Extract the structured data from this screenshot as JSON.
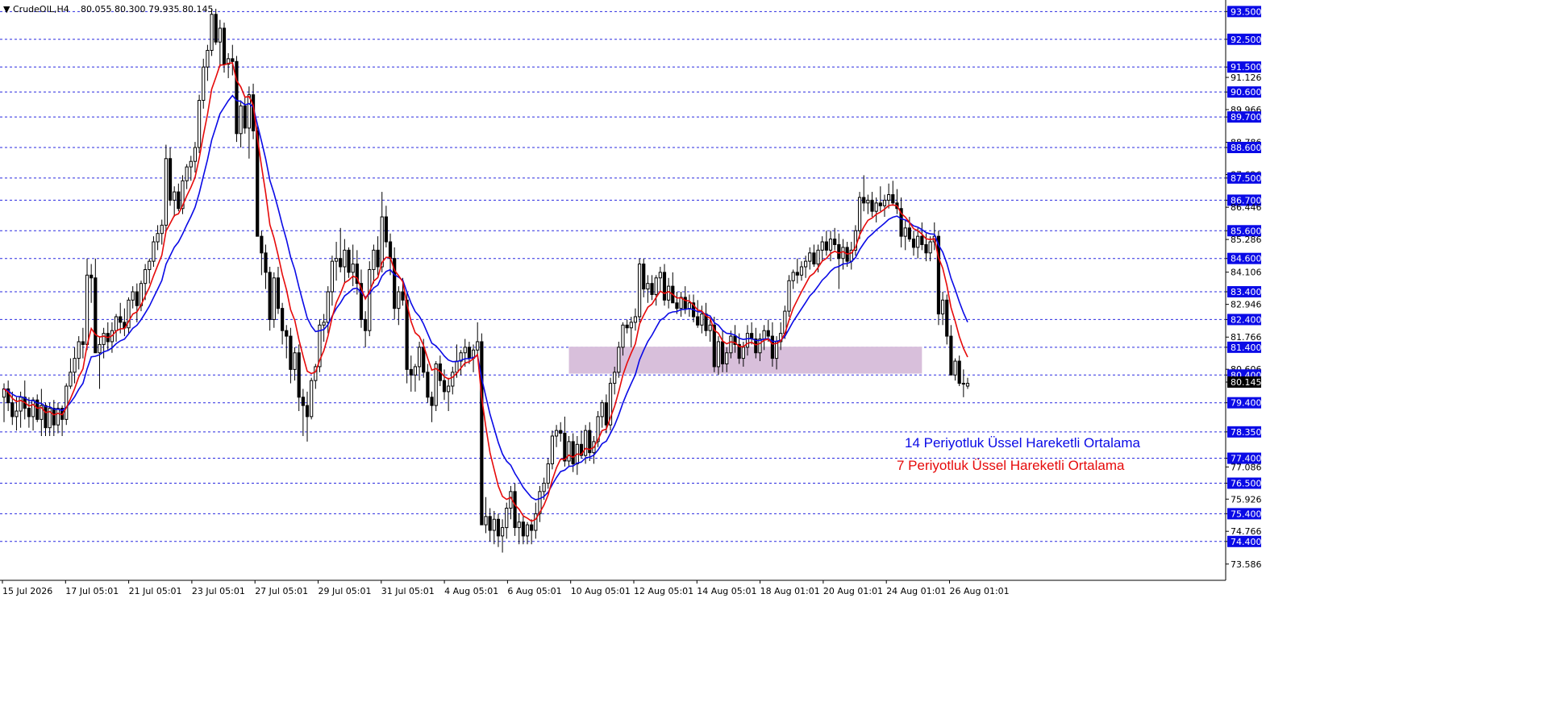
{
  "header": {
    "symbol_tf": "CrudeOIL,H4",
    "ohlc": "80.055 80.300 79.935 80.145"
  },
  "annotations": {
    "ema14_label": "14 Periyotluk Üssel Hareketli Ortalama",
    "ema7_label": "7  Periyotluk Üssel Hareketli Ortalama"
  },
  "colors": {
    "bull": "#ffffff",
    "bear": "#000000",
    "ema14": "#0a0ae6",
    "ema7": "#e60a0a",
    "level_line": "#2a2ae0",
    "level_label_bg": "#0a0ae6",
    "current_price_bg": "#000000",
    "zone_fill": "#d8bfdb"
  },
  "chart_data": {
    "type": "candlestick",
    "ylim": [
      73.0,
      93.8
    ],
    "y_ticks": [
      "93.500",
      "92.500",
      "91.500",
      "91.126",
      "90.600",
      "89.966",
      "89.700",
      "88.786",
      "88.600",
      "87.626",
      "87.500",
      "86.700",
      "86.446",
      "85.600",
      "85.286",
      "84.600",
      "84.106",
      "83.400",
      "82.946",
      "82.400",
      "81.766",
      "81.400",
      "80.606",
      "80.400",
      "80.145",
      "79.400",
      "78.350",
      "77.400",
      "77.086",
      "76.500",
      "75.926",
      "75.400",
      "74.766",
      "74.400",
      "73.586"
    ],
    "levels": [
      93.5,
      92.5,
      91.5,
      90.6,
      89.7,
      88.6,
      87.5,
      86.7,
      85.6,
      84.6,
      83.4,
      82.4,
      81.4,
      80.4,
      79.4,
      78.35,
      77.4,
      76.5,
      75.4,
      74.4
    ],
    "current_price": "80.145",
    "x_labels": [
      "15 Jul 2026",
      "17 Jul 05:01",
      "21 Jul 05:01",
      "23 Jul 05:01",
      "27 Jul 05:01",
      "29 Jul 05:01",
      "31 Jul 05:01",
      "4 Aug 05:01",
      "6 Aug 05:01",
      "10 Aug 05:01",
      "12 Aug 05:01",
      "14 Aug 05:01",
      "18 Aug 01:01",
      "20 Aug 01:01",
      "24 Aug 01:01",
      "26 Aug 01:01"
    ],
    "zone": {
      "from_bar": 136,
      "to_bar": 221,
      "low": 80.45,
      "high": 81.42
    },
    "ohlc": [
      [
        79.6,
        80.1,
        78.7,
        79.9
      ],
      [
        79.9,
        80.2,
        79.1,
        79.4
      ],
      [
        79.4,
        79.8,
        78.6,
        78.9
      ],
      [
        78.9,
        79.6,
        78.4,
        79.1
      ],
      [
        79.1,
        79.8,
        78.5,
        79.6
      ],
      [
        79.6,
        80.2,
        78.8,
        79.2
      ],
      [
        79.2,
        79.6,
        78.5,
        78.9
      ],
      [
        78.9,
        79.6,
        78.4,
        79.5
      ],
      [
        79.5,
        79.7,
        78.7,
        78.8
      ],
      [
        78.8,
        79.9,
        78.2,
        79.3
      ],
      [
        79.3,
        79.4,
        78.2,
        78.5
      ],
      [
        78.5,
        79.4,
        78.2,
        79.2
      ],
      [
        79.2,
        79.5,
        78.2,
        78.6
      ],
      [
        78.6,
        79.4,
        78.3,
        79.2
      ],
      [
        79.2,
        79.3,
        78.2,
        78.8
      ],
      [
        78.8,
        80.1,
        78.6,
        80.0
      ],
      [
        80.0,
        81.0,
        79.9,
        80.5
      ],
      [
        80.5,
        81.4,
        80.1,
        81.0
      ],
      [
        81.0,
        81.8,
        80.6,
        81.6
      ],
      [
        81.6,
        82.1,
        81.0,
        81.5
      ],
      [
        81.5,
        84.6,
        81.3,
        84.0
      ],
      [
        84.0,
        84.4,
        83.0,
        83.9
      ],
      [
        83.9,
        84.6,
        83.0,
        81.2
      ],
      [
        81.2,
        81.8,
        79.9,
        81.5
      ],
      [
        81.5,
        82.1,
        81.0,
        81.9
      ],
      [
        81.9,
        82.3,
        81.3,
        81.6
      ],
      [
        81.6,
        82.3,
        81.2,
        82.0
      ],
      [
        82.0,
        82.6,
        81.6,
        82.5
      ],
      [
        82.5,
        83.0,
        81.9,
        82.3
      ],
      [
        82.3,
        82.8,
        81.8,
        82.1
      ],
      [
        82.1,
        83.2,
        81.9,
        83.1
      ],
      [
        83.1,
        83.6,
        82.8,
        83.4
      ],
      [
        83.4,
        83.7,
        82.3,
        82.9
      ],
      [
        82.9,
        83.8,
        82.7,
        83.7
      ],
      [
        83.7,
        84.4,
        83.1,
        84.2
      ],
      [
        84.2,
        84.6,
        83.7,
        84.5
      ],
      [
        84.5,
        85.4,
        84.3,
        85.2
      ],
      [
        85.2,
        85.8,
        84.9,
        85.5
      ],
      [
        85.5,
        86.0,
        85.1,
        85.8
      ],
      [
        85.8,
        88.7,
        85.6,
        88.2
      ],
      [
        88.2,
        88.6,
        86.5,
        86.7
      ],
      [
        86.7,
        87.2,
        86.1,
        87.0
      ],
      [
        87.0,
        87.3,
        86.3,
        86.4
      ],
      [
        86.4,
        87.6,
        86.2,
        87.4
      ],
      [
        87.4,
        88.0,
        87.1,
        87.9
      ],
      [
        87.9,
        88.3,
        87.4,
        88.1
      ],
      [
        88.1,
        88.8,
        87.7,
        88.6
      ],
      [
        88.6,
        90.5,
        88.4,
        90.3
      ],
      [
        90.3,
        91.8,
        90.0,
        91.5
      ],
      [
        91.5,
        92.3,
        91.0,
        92.1
      ],
      [
        92.1,
        93.6,
        91.9,
        93.4
      ],
      [
        93.4,
        93.6,
        92.3,
        92.4
      ],
      [
        92.4,
        93.2,
        91.5,
        92.9
      ],
      [
        92.9,
        93.1,
        91.3,
        91.6
      ],
      [
        91.6,
        92.0,
        91.1,
        91.8
      ],
      [
        91.8,
        92.3,
        91.2,
        91.7
      ],
      [
        91.7,
        91.9,
        88.8,
        89.1
      ],
      [
        89.1,
        90.3,
        88.6,
        90.1
      ],
      [
        90.1,
        90.4,
        89.1,
        89.3
      ],
      [
        89.3,
        90.8,
        88.2,
        90.5
      ],
      [
        90.5,
        90.9,
        88.9,
        89.2
      ],
      [
        89.2,
        89.4,
        86.2,
        85.4
      ],
      [
        85.4,
        85.6,
        84.0,
        84.8
      ],
      [
        84.8,
        85.1,
        83.5,
        84.1
      ],
      [
        84.1,
        84.3,
        82.0,
        82.4
      ],
      [
        82.4,
        84.1,
        82.1,
        83.9
      ],
      [
        83.9,
        84.3,
        82.6,
        82.8
      ],
      [
        82.8,
        83.0,
        81.5,
        82.0
      ],
      [
        82.0,
        82.2,
        81.0,
        81.8
      ],
      [
        81.8,
        82.1,
        80.1,
        80.6
      ],
      [
        80.6,
        81.4,
        80.2,
        81.2
      ],
      [
        81.2,
        81.5,
        79.1,
        79.6
      ],
      [
        79.6,
        79.9,
        78.2,
        79.3
      ],
      [
        79.3,
        79.8,
        78.0,
        78.9
      ],
      [
        78.9,
        80.3,
        78.8,
        80.2
      ],
      [
        80.2,
        80.8,
        79.9,
        80.7
      ],
      [
        80.7,
        82.4,
        80.5,
        82.2
      ],
      [
        82.2,
        82.6,
        81.6,
        82.3
      ],
      [
        82.3,
        83.6,
        81.9,
        83.4
      ],
      [
        83.4,
        84.7,
        82.9,
        84.5
      ],
      [
        84.5,
        85.2,
        83.8,
        84.6
      ],
      [
        84.6,
        85.7,
        84.1,
        84.3
      ],
      [
        84.3,
        85.3,
        83.7,
        84.9
      ],
      [
        84.9,
        85.0,
        83.9,
        84.1
      ],
      [
        84.1,
        85.1,
        83.6,
        84.4
      ],
      [
        84.4,
        84.9,
        83.3,
        83.7
      ],
      [
        83.7,
        84.2,
        82.1,
        82.4
      ],
      [
        82.4,
        82.7,
        81.4,
        82.0
      ],
      [
        82.0,
        84.5,
        81.8,
        84.2
      ],
      [
        84.2,
        85.1,
        83.7,
        84.9
      ],
      [
        84.9,
        85.4,
        84.0,
        84.3
      ],
      [
        84.3,
        87.0,
        84.1,
        86.1
      ],
      [
        86.1,
        86.5,
        85.0,
        85.2
      ],
      [
        85.2,
        85.5,
        84.0,
        84.6
      ],
      [
        84.6,
        85.0,
        82.4,
        82.8
      ],
      [
        82.8,
        83.6,
        82.2,
        83.4
      ],
      [
        83.4,
        83.9,
        82.9,
        83.1
      ],
      [
        83.1,
        83.4,
        80.1,
        80.6
      ],
      [
        80.6,
        81.1,
        79.8,
        80.4
      ],
      [
        80.4,
        80.8,
        79.8,
        80.7
      ],
      [
        80.7,
        81.6,
        80.2,
        81.4
      ],
      [
        81.4,
        81.7,
        80.3,
        80.5
      ],
      [
        80.5,
        80.8,
        79.4,
        79.6
      ],
      [
        79.6,
        79.8,
        78.7,
        79.3
      ],
      [
        79.3,
        80.9,
        79.1,
        80.8
      ],
      [
        80.8,
        81.1,
        80.0,
        80.2
      ],
      [
        80.2,
        80.6,
        79.5,
        79.8
      ],
      [
        79.8,
        80.3,
        79.1,
        80.0
      ],
      [
        80.0,
        80.7,
        79.7,
        80.5
      ],
      [
        80.5,
        81.5,
        80.3,
        80.9
      ],
      [
        80.9,
        81.3,
        80.4,
        81.2
      ],
      [
        81.2,
        81.7,
        80.7,
        81.4
      ],
      [
        81.4,
        81.6,
        80.8,
        81.0
      ],
      [
        81.0,
        81.5,
        80.5,
        81.3
      ],
      [
        81.3,
        82.3,
        81.1,
        81.6
      ],
      [
        81.6,
        81.9,
        78.0,
        75.0
      ],
      [
        75.0,
        76.0,
        74.7,
        75.3
      ],
      [
        75.3,
        75.6,
        74.4,
        74.8
      ],
      [
        74.8,
        75.5,
        74.3,
        75.2
      ],
      [
        75.2,
        75.4,
        74.2,
        74.6
      ],
      [
        74.6,
        75.2,
        74.0,
        74.9
      ],
      [
        74.9,
        75.8,
        74.5,
        75.6
      ],
      [
        75.6,
        76.4,
        75.2,
        76.2
      ],
      [
        76.2,
        76.5,
        74.6,
        74.9
      ],
      [
        74.9,
        75.4,
        74.3,
        75.1
      ],
      [
        75.1,
        75.3,
        74.3,
        74.6
      ],
      [
        74.6,
        75.1,
        74.3,
        75.0
      ],
      [
        75.0,
        75.2,
        74.3,
        74.8
      ],
      [
        74.8,
        75.8,
        74.5,
        75.4
      ],
      [
        75.4,
        76.4,
        75.1,
        76.2
      ],
      [
        76.2,
        76.7,
        75.9,
        76.5
      ],
      [
        76.5,
        77.4,
        76.3,
        77.2
      ],
      [
        77.2,
        78.4,
        77.0,
        78.2
      ],
      [
        78.2,
        78.6,
        77.8,
        78.4
      ],
      [
        78.4,
        78.7,
        78.0,
        78.3
      ],
      [
        78.3,
        78.9,
        77.1,
        77.3
      ],
      [
        77.3,
        78.2,
        77.1,
        78.0
      ],
      [
        78.0,
        78.3,
        76.9,
        77.2
      ],
      [
        77.2,
        78.2,
        76.8,
        77.9
      ],
      [
        77.9,
        78.4,
        77.4,
        77.5
      ],
      [
        77.5,
        78.6,
        77.2,
        78.4
      ],
      [
        78.4,
        78.7,
        77.3,
        77.6
      ],
      [
        77.6,
        78.2,
        77.2,
        78.0
      ],
      [
        78.0,
        79.1,
        77.8,
        78.9
      ],
      [
        78.9,
        79.5,
        78.5,
        79.4
      ],
      [
        79.4,
        79.7,
        78.3,
        78.6
      ],
      [
        78.6,
        80.3,
        78.4,
        80.1
      ],
      [
        80.1,
        80.7,
        79.7,
        80.5
      ],
      [
        80.5,
        81.6,
        80.3,
        81.4
      ],
      [
        81.4,
        82.3,
        81.1,
        82.2
      ],
      [
        82.2,
        82.4,
        81.9,
        82.1
      ],
      [
        82.1,
        82.5,
        81.4,
        82.3
      ],
      [
        82.3,
        82.8,
        82.0,
        82.5
      ],
      [
        82.5,
        84.6,
        82.3,
        84.4
      ],
      [
        84.4,
        84.6,
        83.2,
        83.5
      ],
      [
        83.5,
        84.0,
        83.0,
        83.7
      ],
      [
        83.7,
        84.0,
        83.1,
        83.3
      ],
      [
        83.3,
        84.0,
        82.9,
        83.9
      ],
      [
        83.9,
        84.3,
        83.4,
        84.1
      ],
      [
        84.1,
        84.4,
        82.9,
        83.1
      ],
      [
        83.1,
        83.9,
        82.8,
        83.6
      ],
      [
        83.6,
        84.1,
        83.3,
        83.0
      ],
      [
        83.0,
        83.4,
        82.6,
        82.8
      ],
      [
        82.8,
        83.4,
        82.5,
        83.2
      ],
      [
        83.2,
        83.6,
        82.6,
        82.8
      ],
      [
        82.8,
        83.3,
        82.5,
        83.0
      ],
      [
        83.0,
        83.3,
        82.3,
        82.5
      ],
      [
        82.5,
        83.1,
        82.1,
        82.2
      ],
      [
        82.2,
        82.9,
        81.9,
        82.6
      ],
      [
        82.6,
        83.0,
        81.8,
        82.0
      ],
      [
        82.0,
        82.4,
        81.6,
        82.2
      ],
      [
        82.2,
        82.5,
        80.5,
        80.7
      ],
      [
        80.7,
        81.8,
        80.4,
        81.6
      ],
      [
        81.6,
        82.0,
        80.5,
        80.8
      ],
      [
        80.8,
        81.4,
        80.5,
        81.2
      ],
      [
        81.2,
        82.0,
        81.0,
        81.8
      ],
      [
        81.8,
        82.2,
        81.2,
        81.5
      ],
      [
        81.5,
        81.9,
        80.8,
        81.0
      ],
      [
        81.0,
        81.6,
        80.7,
        81.4
      ],
      [
        81.4,
        82.2,
        81.1,
        81.9
      ],
      [
        81.9,
        82.3,
        81.5,
        81.7
      ],
      [
        81.7,
        82.1,
        81.0,
        81.2
      ],
      [
        81.2,
        81.9,
        80.9,
        81.7
      ],
      [
        81.7,
        82.2,
        81.3,
        82.0
      ],
      [
        82.0,
        82.4,
        81.6,
        81.8
      ],
      [
        81.8,
        82.3,
        80.7,
        81.0
      ],
      [
        81.0,
        81.8,
        80.6,
        81.6
      ],
      [
        81.6,
        82.3,
        81.3,
        81.9
      ],
      [
        81.9,
        82.9,
        81.7,
        82.7
      ],
      [
        82.7,
        84.0,
        82.5,
        83.8
      ],
      [
        83.8,
        84.2,
        83.5,
        84.1
      ],
      [
        84.1,
        84.6,
        83.7,
        84.0
      ],
      [
        84.0,
        84.5,
        83.8,
        84.3
      ],
      [
        84.3,
        84.7,
        83.9,
        84.5
      ],
      [
        84.5,
        85.0,
        84.2,
        84.8
      ],
      [
        84.8,
        85.1,
        84.3,
        84.4
      ],
      [
        84.4,
        85.1,
        84.1,
        84.9
      ],
      [
        84.9,
        85.4,
        84.5,
        85.2
      ],
      [
        85.2,
        85.6,
        84.7,
        84.9
      ],
      [
        84.9,
        85.6,
        84.5,
        85.3
      ],
      [
        85.3,
        85.7,
        84.9,
        85.1
      ],
      [
        85.1,
        85.5,
        83.5,
        84.6
      ],
      [
        84.6,
        85.3,
        84.2,
        85.0
      ],
      [
        85.0,
        85.2,
        84.3,
        84.5
      ],
      [
        84.5,
        85.2,
        84.2,
        84.9
      ],
      [
        84.9,
        85.8,
        84.7,
        85.6
      ],
      [
        85.6,
        87.0,
        85.3,
        86.8
      ],
      [
        86.8,
        87.6,
        86.3,
        86.6
      ],
      [
        86.6,
        86.9,
        86.2,
        86.7
      ],
      [
        86.7,
        87.0,
        86.1,
        86.3
      ],
      [
        86.3,
        86.8,
        85.9,
        86.6
      ],
      [
        86.6,
        87.2,
        86.3,
        86.5
      ],
      [
        86.5,
        86.9,
        86.1,
        86.7
      ],
      [
        86.7,
        87.3,
        86.4,
        86.9
      ],
      [
        86.9,
        87.4,
        86.5,
        86.6
      ],
      [
        86.6,
        87.1,
        86.2,
        86.4
      ],
      [
        86.4,
        86.8,
        85.0,
        85.4
      ],
      [
        85.4,
        86.0,
        84.9,
        85.7
      ],
      [
        85.7,
        86.1,
        85.2,
        85.3
      ],
      [
        85.3,
        85.6,
        84.7,
        85.0
      ],
      [
        85.0,
        85.7,
        84.6,
        85.4
      ],
      [
        85.4,
        85.9,
        84.9,
        85.1
      ],
      [
        85.1,
        85.5,
        84.5,
        84.8
      ],
      [
        84.8,
        85.4,
        84.5,
        85.2
      ],
      [
        85.2,
        85.9,
        84.9,
        85.4
      ],
      [
        85.4,
        85.6,
        82.2,
        82.6
      ],
      [
        82.6,
        83.4,
        82.2,
        83.1
      ],
      [
        83.1,
        83.3,
        81.5,
        81.8
      ],
      [
        81.8,
        82.2,
        80.6,
        80.4
      ],
      [
        80.4,
        81.0,
        80.2,
        80.9
      ],
      [
        80.9,
        81.1,
        80.0,
        80.1
      ],
      [
        80.1,
        80.6,
        79.6,
        80.1
      ],
      [
        80.0,
        80.3,
        79.9,
        80.1
      ]
    ]
  }
}
